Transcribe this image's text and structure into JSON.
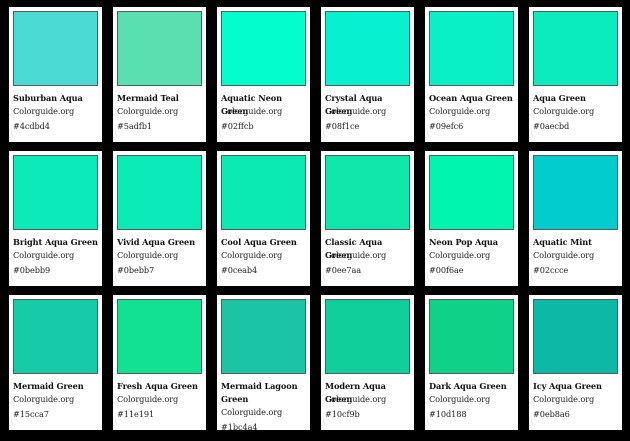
{
  "swatches": [
    {
      "name": "Suburban Aqua",
      "site": "Colorguide.org",
      "hex": "#4cdbd4",
      "color": "#4cdbd4"
    },
    {
      "name": "Mermaid Teal",
      "site": "Colorguide.org",
      "hex": "#5adfb1",
      "color": "#5adfb1"
    },
    {
      "name": "Aquatic Neon Green",
      "site": "Colorguide.org",
      "hex": "#02ffcb",
      "color": "#02ffcb"
    },
    {
      "name": "Crystal Aqua Green",
      "site": "Colorguide.org",
      "hex": "#08f1ce",
      "color": "#08f1ce"
    },
    {
      "name": "Ocean Aqua Green",
      "site": "Colorguide.org",
      "hex": "#09efc6",
      "color": "#09efc6"
    },
    {
      "name": "Aqua Green",
      "site": "Colorguide.org",
      "hex": "#0aecbd",
      "color": "#0aecbd"
    },
    {
      "name": "Bright Aqua Green",
      "site": "Colorguide.org",
      "hex": "#0bebb9",
      "color": "#0bebb9"
    },
    {
      "name": "Vivid Aqua Green",
      "site": "Colorguide.org",
      "hex": "#0bebb7",
      "color": "#0bebb7"
    },
    {
      "name": "Cool Aqua Green",
      "site": "Colorguide.org",
      "hex": "#0ceab4",
      "color": "#0ceab4"
    },
    {
      "name": "Classic Aqua Green",
      "site": "Colorguide.org",
      "hex": "#0ee7aa",
      "color": "#0ee7aa"
    },
    {
      "name": "Neon Pop Aqua",
      "site": "Colorguide.org",
      "hex": "#00f6ae",
      "color": "#00f6ae"
    },
    {
      "name": "Aquatic Mint",
      "site": "Colorguide.org",
      "hex": "#02ccce",
      "color": "#02ccce"
    },
    {
      "name": "Mermaid Green",
      "site": "Colorguide.org",
      "hex": "#15cca7",
      "color": "#15cca7"
    },
    {
      "name": "Fresh Aqua Green",
      "site": "Colorguide.org",
      "hex": "#11e191",
      "color": "#11e191"
    },
    {
      "name": "Mermaid Lagoon Green",
      "site": "Colorguide.org",
      "hex": "#1bc4a4",
      "color": "#1bc4a4"
    },
    {
      "name": "Modern Aqua Green",
      "site": "Colorguide.org",
      "hex": "#10cf9b",
      "color": "#10cf9b"
    },
    {
      "name": "Dark Aqua Green",
      "site": "Colorguide.org",
      "hex": "#10d188",
      "color": "#10d188"
    },
    {
      "name": "Icy Aqua Green",
      "site": "Colorguide.org",
      "hex": "#0eb8a6",
      "color": "#0eb8a6"
    }
  ]
}
